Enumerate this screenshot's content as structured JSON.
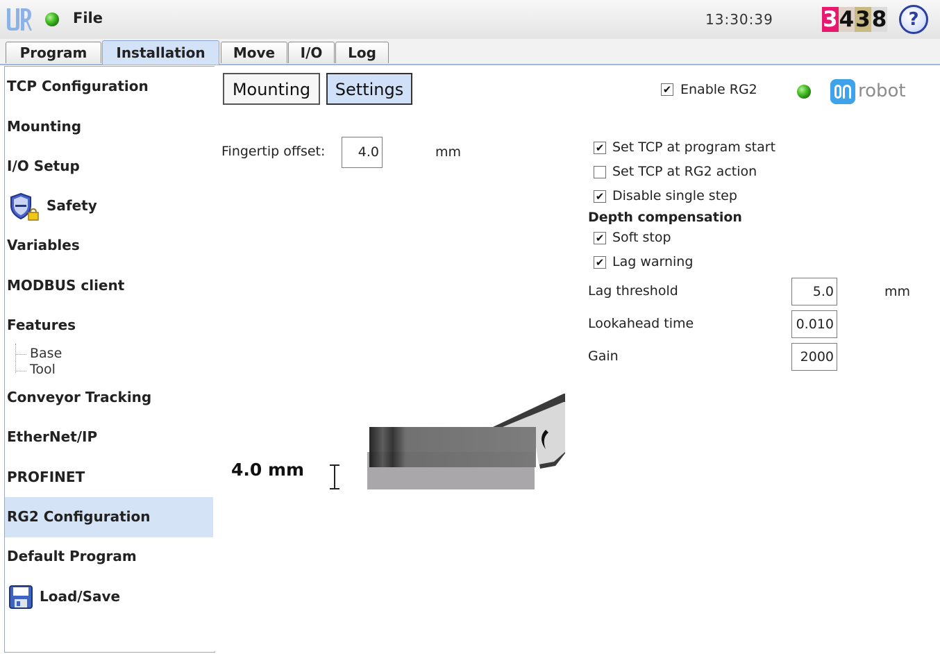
{
  "header": {
    "file_label": "File",
    "clock": "13:30:39",
    "speed_digits": [
      "3",
      "4",
      "3",
      "8"
    ],
    "help_label": "?",
    "robot_status_color": "#4cc52a"
  },
  "tabs": [
    {
      "label": "Program",
      "active": false
    },
    {
      "label": "Installation",
      "active": true
    },
    {
      "label": "Move",
      "active": false
    },
    {
      "label": "I/O",
      "active": false
    },
    {
      "label": "Log",
      "active": false
    }
  ],
  "sidebar": {
    "items": [
      {
        "label": "TCP Configuration"
      },
      {
        "label": "Mounting"
      },
      {
        "label": "I/O Setup"
      },
      {
        "label": "Safety",
        "icon": "shield-lock-icon"
      },
      {
        "label": "Variables"
      },
      {
        "label": "MODBUS client"
      },
      {
        "label": "Features"
      },
      {
        "label": "Conveyor Tracking"
      },
      {
        "label": "EtherNet/IP"
      },
      {
        "label": "PROFINET"
      },
      {
        "label": "RG2 Configuration",
        "selected": true
      },
      {
        "label": "Default Program"
      },
      {
        "label": "Load/Save",
        "icon": "floppy-disk-icon"
      }
    ],
    "feature_children": [
      "Base",
      "Tool"
    ]
  },
  "rg2": {
    "subtabs": [
      {
        "label": "Mounting",
        "active": false
      },
      {
        "label": "Settings",
        "active": true
      }
    ],
    "enable_label": "Enable RG2",
    "enable_checked": true,
    "status_led_color": "#4cc52a",
    "brand_logo_text": "robot",
    "fingertip_label": "Fingertip offset:",
    "fingertip_value": "4.0",
    "fingertip_unit": "mm",
    "options": [
      {
        "label": "Set TCP at program start",
        "checked": true
      },
      {
        "label": "Set TCP at RG2 action",
        "checked": false
      },
      {
        "label": "Disable single step",
        "checked": true
      }
    ],
    "depth_heading": "Depth compensation",
    "depth_options": [
      {
        "label": "Soft stop",
        "checked": true
      },
      {
        "label": "Lag warning",
        "checked": true
      }
    ],
    "lag_threshold_label": "Lag threshold",
    "lag_threshold_value": "5.0",
    "lag_threshold_unit": "mm",
    "lookahead_label": "Lookahead time",
    "lookahead_value": "0.010",
    "gain_label": "Gain",
    "gain_value": "2000",
    "preview_offset_text": "4.0 mm"
  }
}
